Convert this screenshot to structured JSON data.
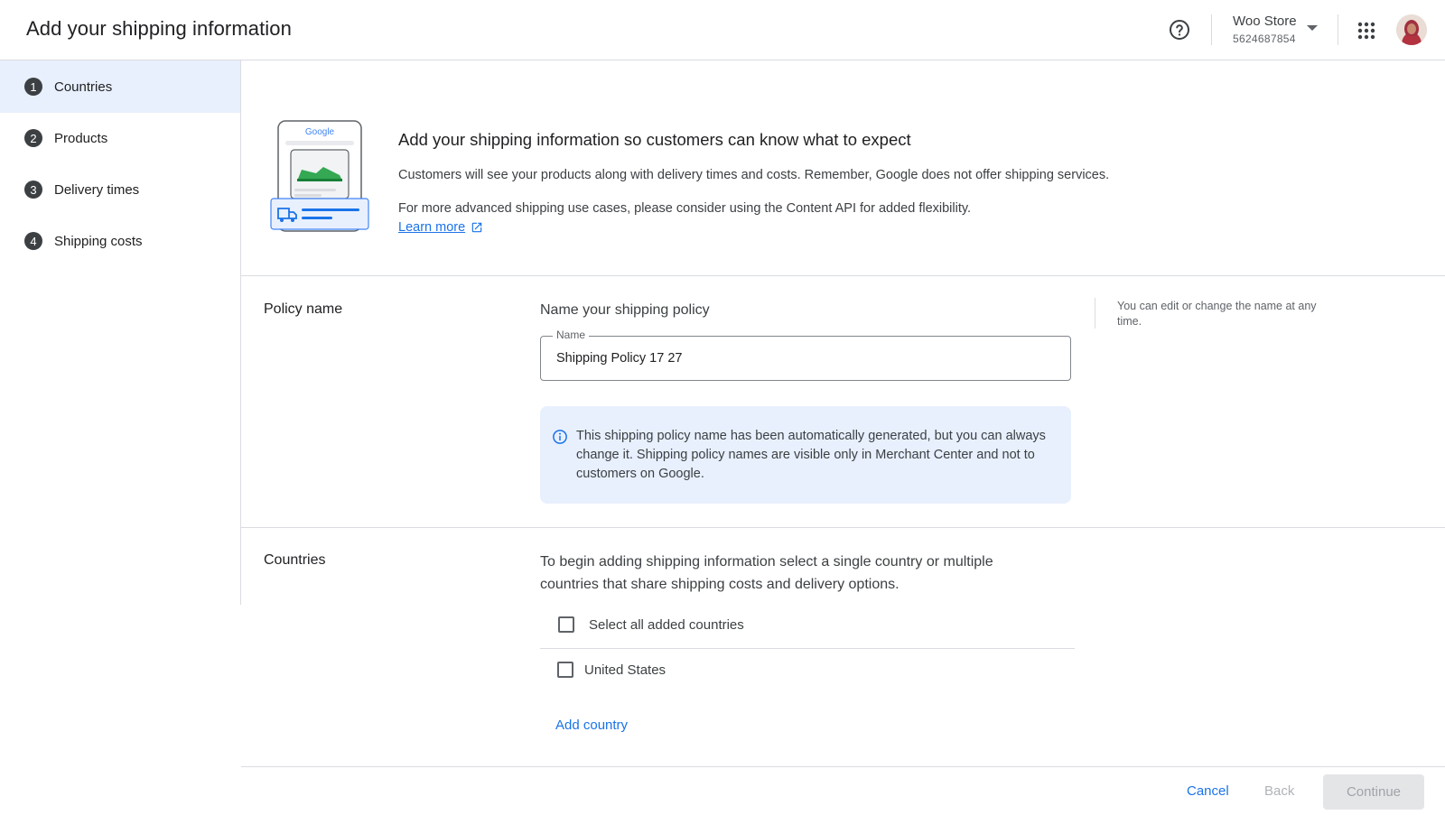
{
  "header": {
    "title": "Add your shipping information",
    "help_icon": "help-circle-icon",
    "account": {
      "name": "Woo Store",
      "id": "5624687854"
    },
    "apps_icon": "apps-grid-icon"
  },
  "sidebar": {
    "steps": [
      {
        "num": "1",
        "label": "Countries",
        "active": true
      },
      {
        "num": "2",
        "label": "Products",
        "active": false
      },
      {
        "num": "3",
        "label": "Delivery times",
        "active": false
      },
      {
        "num": "4",
        "label": "Shipping costs",
        "active": false
      }
    ]
  },
  "intro": {
    "illustration_label": "Google",
    "title": "Add your shipping information so customers can know what to expect",
    "paragraph1": "Customers will see your products along with delivery times and costs. Remember, Google does not offer shipping services.",
    "paragraph2": "For more advanced shipping use cases, please consider using the Content API for added flexibility.",
    "learn_more": "Learn more"
  },
  "policy": {
    "section_label": "Policy name",
    "heading": "Name your shipping policy",
    "field_label": "Name",
    "field_value": "Shipping Policy 17 27",
    "side_note": "You can edit or change the name at any time.",
    "info_text": "This shipping policy name has been automatically generated, but you can always change it. Shipping policy names are visible only in Merchant Center and not to customers on Google."
  },
  "countries": {
    "section_label": "Countries",
    "intro": "To begin adding shipping information select a single country or multiple countries that share shipping costs and delivery options.",
    "select_all_label": "Select all added countries",
    "items": [
      {
        "label": "United States",
        "checked": false
      }
    ],
    "add_label": "Add country"
  },
  "footer": {
    "cancel": "Cancel",
    "back": "Back",
    "continue": "Continue"
  },
  "colors": {
    "accent": "#1a73e8",
    "active_step_bg": "#e8f0fe",
    "info_bg": "#e8f0fe",
    "illustration_green": "#34a853"
  }
}
